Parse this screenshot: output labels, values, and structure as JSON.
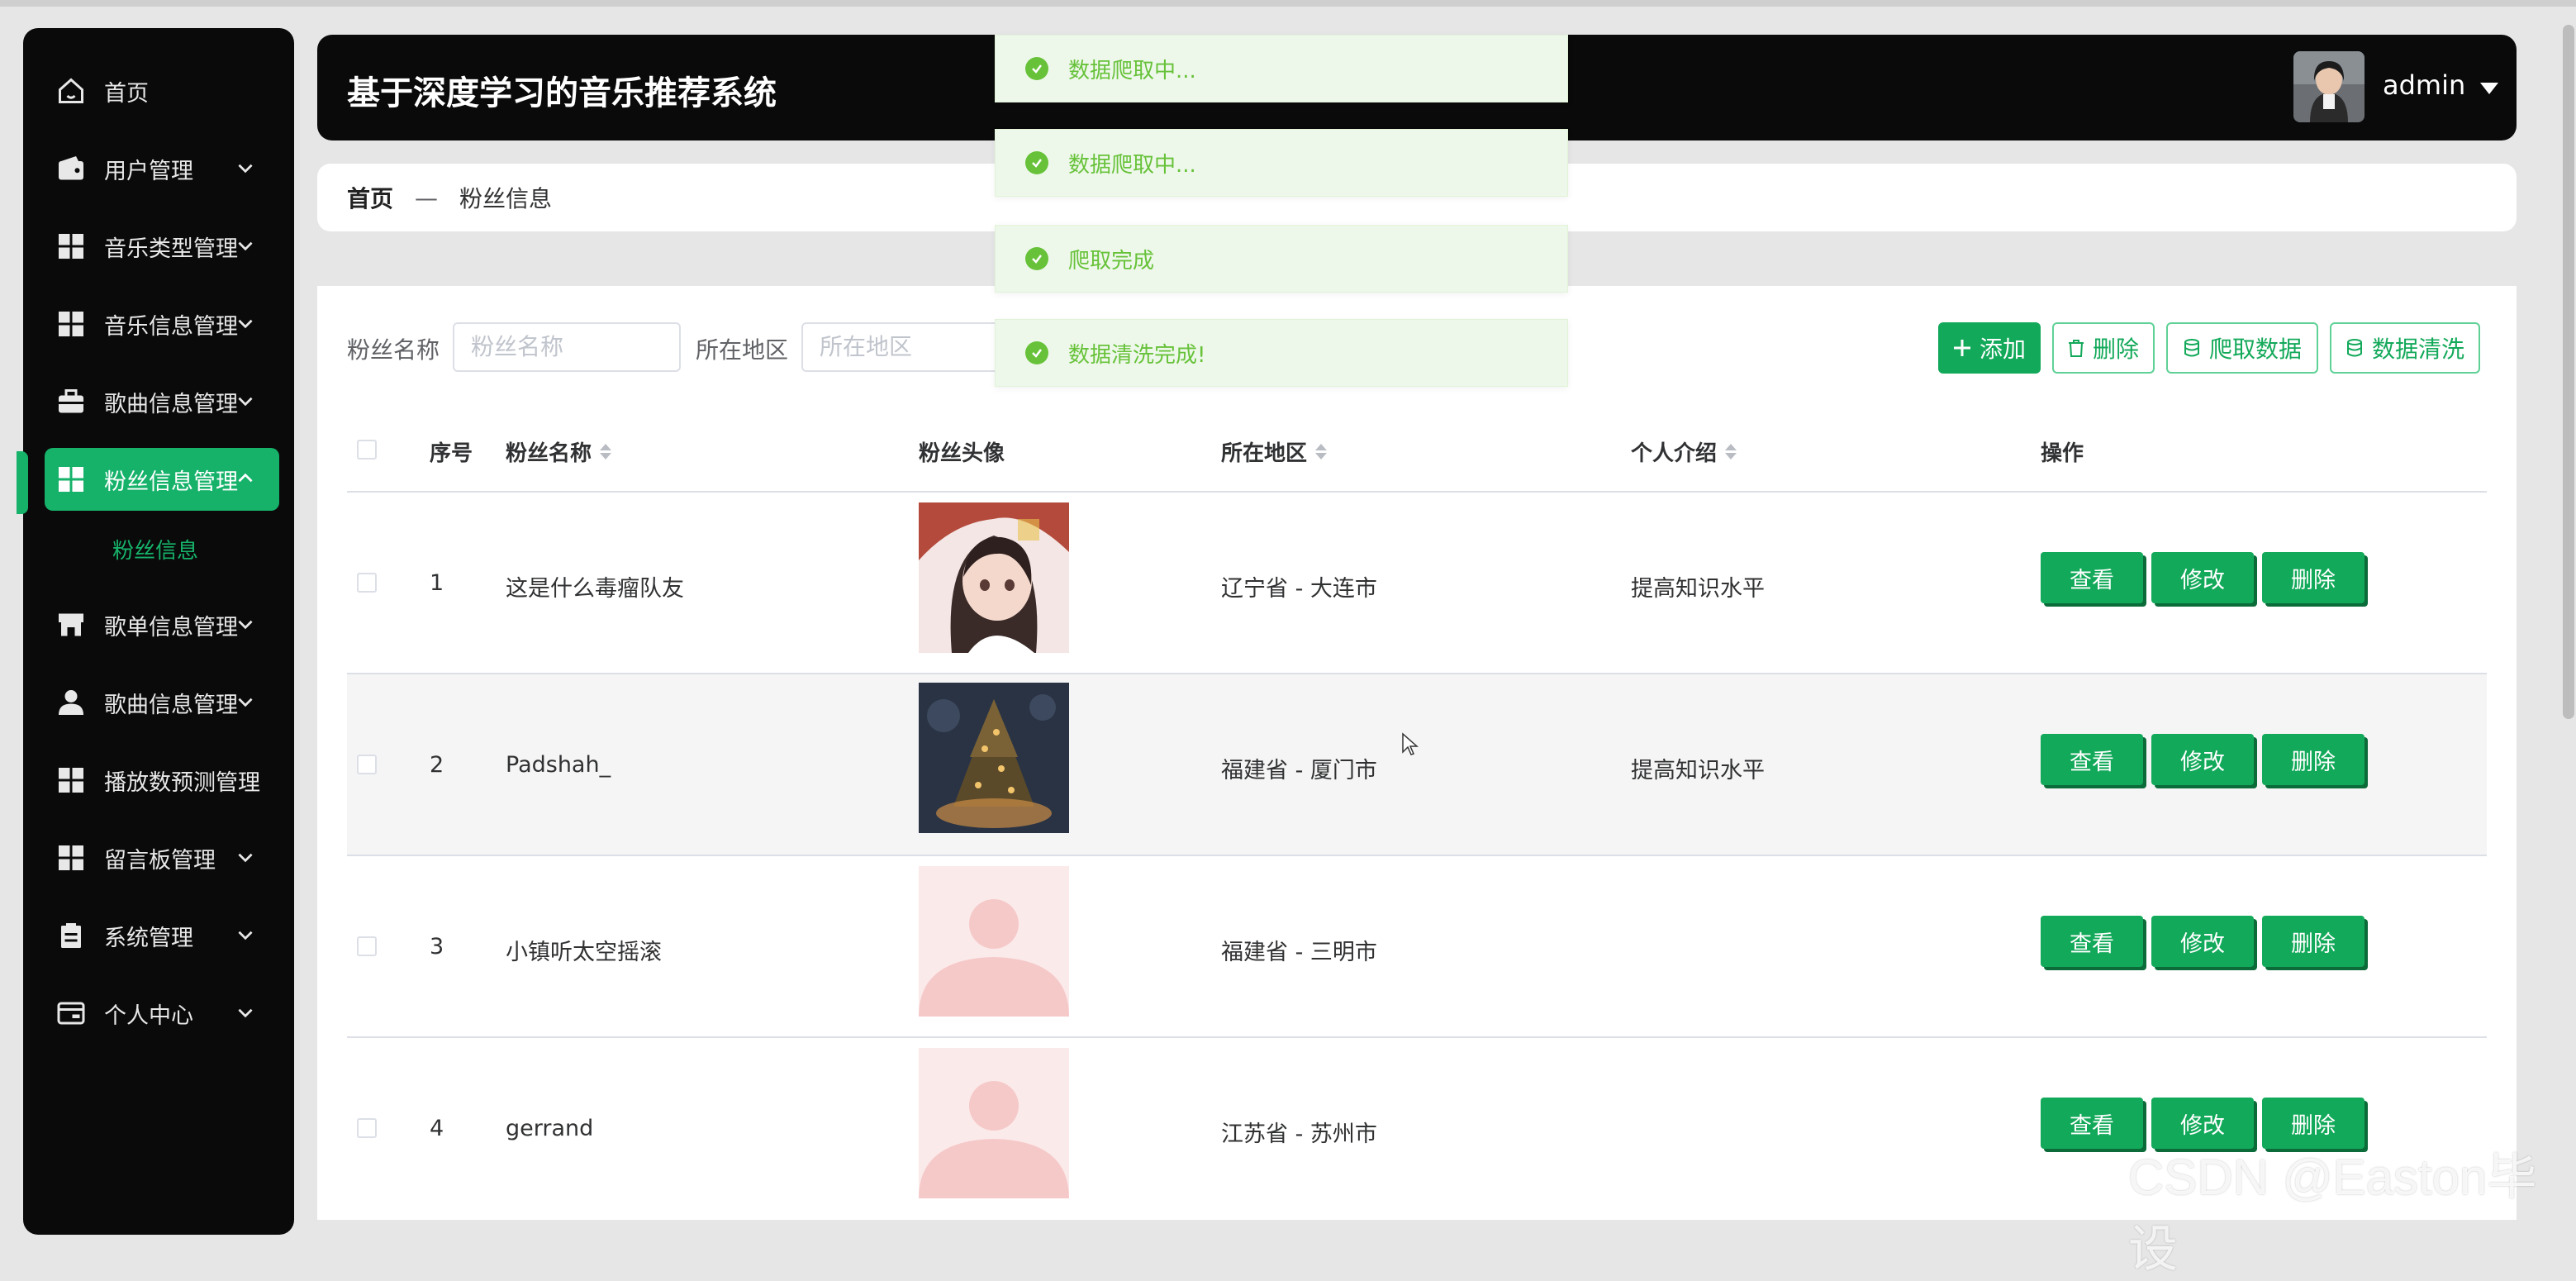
{
  "app": {
    "title": "基于深度学习的音乐推荐系统",
    "user": "admin"
  },
  "sidebar": {
    "items": [
      {
        "label": "首页",
        "icon": "home-icon"
      },
      {
        "label": "用户管理",
        "icon": "wallet-icon"
      },
      {
        "label": "音乐类型管理",
        "icon": "grid-icon"
      },
      {
        "label": "音乐信息管理",
        "icon": "grid-icon"
      },
      {
        "label": "歌曲信息管理",
        "icon": "briefcase-icon"
      },
      {
        "label": "粉丝信息管理",
        "icon": "grid-icon",
        "active": true
      },
      {
        "label": "歌单信息管理",
        "icon": "store-icon"
      },
      {
        "label": "歌曲信息管理",
        "icon": "user-icon"
      },
      {
        "label": "播放数预测管理",
        "icon": "grid-icon"
      },
      {
        "label": "留言板管理",
        "icon": "grid-icon"
      },
      {
        "label": "系统管理",
        "icon": "clipboard-icon"
      },
      {
        "label": "个人中心",
        "icon": "card-icon"
      }
    ],
    "submenu": {
      "label": "粉丝信息"
    }
  },
  "breadcrumb": {
    "home": "首页",
    "separator": "—",
    "current": "粉丝信息"
  },
  "search": {
    "fan_name_label": "粉丝名称",
    "fan_name_placeholder": "粉丝名称",
    "region_label": "所在地区",
    "region_placeholder": "所在地区"
  },
  "toolbar": {
    "add": "添加",
    "delete": "删除",
    "crawl": "爬取数据",
    "clean": "数据清洗"
  },
  "table": {
    "columns": {
      "index": "序号",
      "name": "粉丝名称",
      "avatar": "粉丝头像",
      "region": "所在地区",
      "intro": "个人介绍",
      "actions": "操作"
    },
    "rows": [
      {
        "index": "1",
        "name": "这是什么毒瘤队友",
        "region": "辽宁省 - 大连市",
        "intro": "提高知识水平",
        "avatar": "anime-girl"
      },
      {
        "index": "2",
        "name": "Padshah_",
        "region": "福建省 - 厦门市",
        "intro": "提高知识水平",
        "avatar": "christmas-tree"
      },
      {
        "index": "3",
        "name": "小镇听太空摇滚",
        "region": "福建省 - 三明市",
        "intro": "",
        "avatar": "placeholder"
      },
      {
        "index": "4",
        "name": "gerrand",
        "region": "江苏省 - 苏州市",
        "intro": "",
        "avatar": "placeholder"
      }
    ],
    "row_actions": {
      "view": "查看",
      "edit": "修改",
      "delete": "删除"
    }
  },
  "toasts": [
    {
      "text": "数据爬取中..."
    },
    {
      "text": "数据爬取中..."
    },
    {
      "text": "爬取完成"
    },
    {
      "text": "数据清洗完成!"
    }
  ],
  "watermark": "CSDN @Easton毕设",
  "colors": {
    "accent": "#13a95a",
    "sidebar_bg": "#0a0a0a",
    "toast_bg": "#eef8ea",
    "toast_text": "#67c23a"
  }
}
